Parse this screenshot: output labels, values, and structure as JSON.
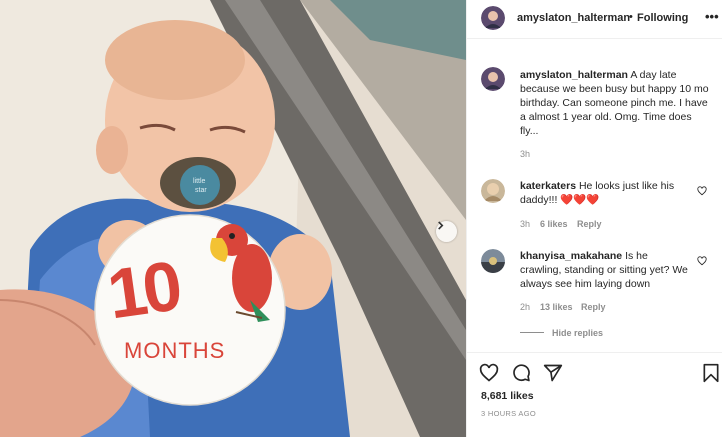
{
  "post": {
    "author": "amyslaton_halterman",
    "follow_status": "Following",
    "caption": {
      "username": "amyslaton_halterman",
      "text": "A day late because we been busy but happy 10 mo birthday. Can someone pinch me. I have a almost 1 year old. Omg. Time does fly...",
      "time": "3h"
    },
    "comments": [
      {
        "username": "katerkaters",
        "text": "He looks just like his daddy!!! ❤️❤️❤️",
        "time": "3h",
        "likes": "6 likes",
        "reply_label": "Reply"
      },
      {
        "username": "khanyisa_makahane",
        "text": "Is he crawling, standing or sitting yet? We always see him laying down",
        "time": "2h",
        "likes": "13 likes",
        "reply_label": "Reply"
      }
    ],
    "hide_replies": "Hide replies",
    "like_count": "8,681 likes",
    "posted_time": "3 HOURS AGO",
    "milestone_card": {
      "number": "10",
      "label": "MONTHS"
    }
  },
  "icons": {
    "more": "more-options-icon",
    "heart": "heart-icon",
    "comment": "comment-icon",
    "share": "share-icon",
    "save": "bookmark-icon",
    "next": "chevron-right-icon"
  },
  "colors": {
    "text": "#262626",
    "muted": "#8e8e8e",
    "divider": "#efefef",
    "heart_red": "#ed4956",
    "card_red": "#d9453a"
  }
}
